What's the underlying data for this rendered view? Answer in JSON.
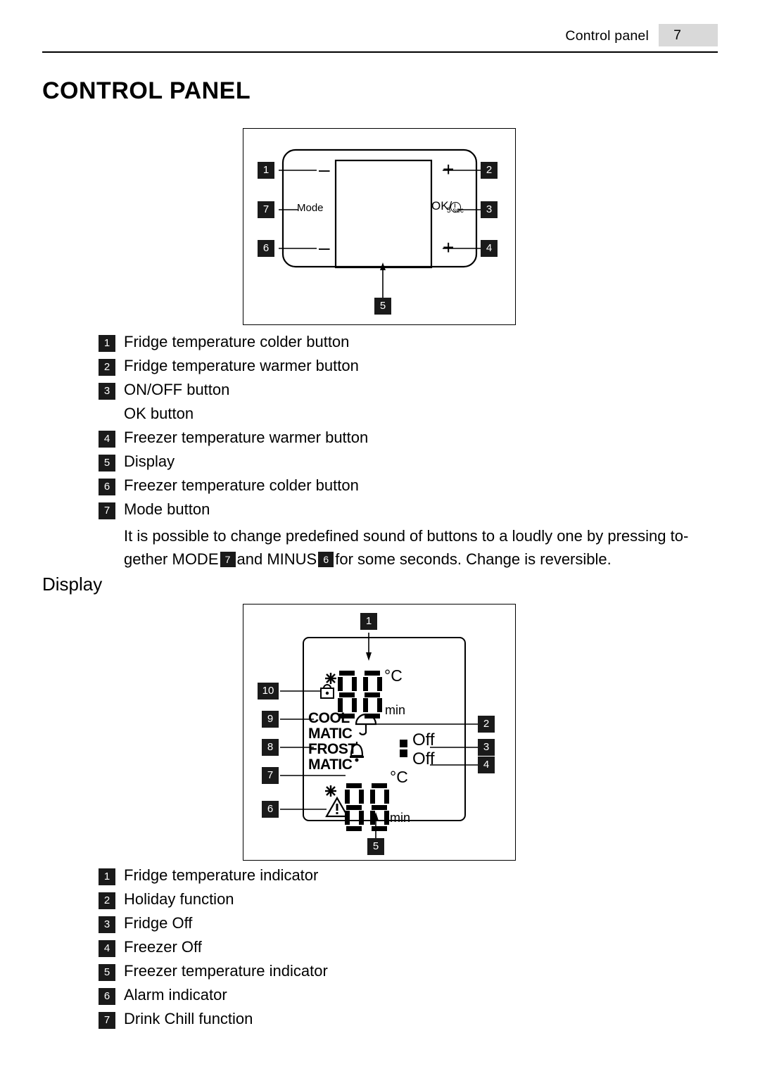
{
  "header": {
    "title": "Control panel",
    "page_number": "7"
  },
  "section1": {
    "heading": "CONTROL PANEL"
  },
  "panel_figure": {
    "callouts": [
      {
        "id": "1",
        "label": "1"
      },
      {
        "id": "2",
        "label": "2"
      },
      {
        "id": "3",
        "label": "3"
      },
      {
        "id": "4",
        "label": "4"
      },
      {
        "id": "5",
        "label": "5"
      },
      {
        "id": "6",
        "label": "6"
      },
      {
        "id": "7",
        "label": "7"
      }
    ],
    "minus_top": "–",
    "minus_bottom": "–",
    "plus_top": "+",
    "plus_bottom": "+",
    "mode_label": "Mode",
    "ok_label": "OK/",
    "ok_sub": "5 sec"
  },
  "panel_legend": [
    {
      "num": "1",
      "text": "Fridge temperature colder button"
    },
    {
      "num": "2",
      "text": "Fridge temperature warmer button"
    },
    {
      "num": "3",
      "text": "ON/OFF button"
    },
    {
      "num": "",
      "text": "OK button"
    },
    {
      "num": "4",
      "text": "Freezer temperature warmer button"
    },
    {
      "num": "5",
      "text": "Display"
    },
    {
      "num": "6",
      "text": "Freezer temperature colder button"
    },
    {
      "num": "7",
      "text": "Mode button"
    }
  ],
  "note": {
    "part1": "It is possible to change predefined sound of buttons to a loudly one by pressing to-",
    "part2_a": "gether MODE",
    "num_a": "7",
    "part2_b": "and MINUS",
    "num_b": "6",
    "part2_c": "for some seconds. Change is reversible."
  },
  "section2": {
    "heading": "Display"
  },
  "display_figure": {
    "callouts": [
      {
        "id": "1",
        "label": "1"
      },
      {
        "id": "2",
        "label": "2"
      },
      {
        "id": "3",
        "label": "3"
      },
      {
        "id": "4",
        "label": "4"
      },
      {
        "id": "5",
        "label": "5"
      },
      {
        "id": "6",
        "label": "6"
      },
      {
        "id": "7",
        "label": "7"
      },
      {
        "id": "8",
        "label": "8"
      },
      {
        "id": "9",
        "label": "9"
      },
      {
        "id": "10",
        "label": "10"
      }
    ],
    "top_digits": "88",
    "bottom_digits": "88",
    "celsius_top": "°C",
    "celsius_bottom": "°C",
    "min_top": "min",
    "min_bottom": "min",
    "cool": "COOL",
    "matic1": "MATIC",
    "frost": "FROST",
    "matic2": "MATIC",
    "off_top": "Off",
    "off_bottom": "Off"
  },
  "display_legend": [
    {
      "num": "1",
      "text": "Fridge temperature indicator"
    },
    {
      "num": "2",
      "text": "Holiday function"
    },
    {
      "num": "3",
      "text": "Fridge Off"
    },
    {
      "num": "4",
      "text": "Freezer Off"
    },
    {
      "num": "5",
      "text": "Freezer temperature indicator"
    },
    {
      "num": "6",
      "text": "Alarm indicator"
    },
    {
      "num": "7",
      "text": "Drink Chill function"
    }
  ]
}
